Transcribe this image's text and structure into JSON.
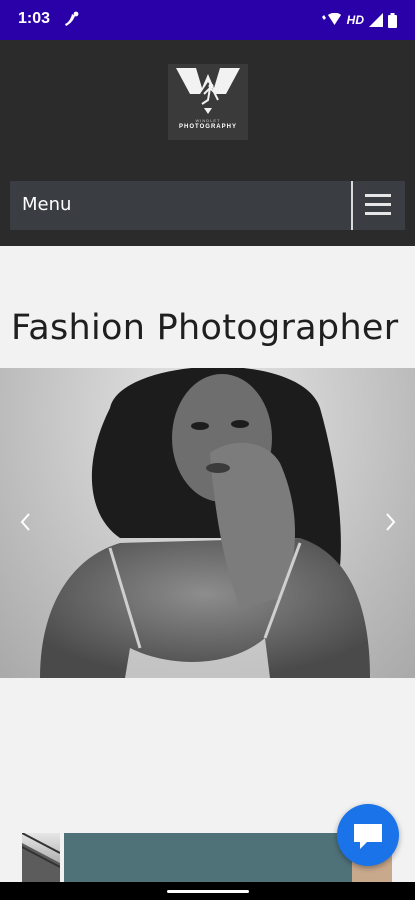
{
  "status_bar": {
    "time": "1:03",
    "network_label": "HD",
    "icons": [
      "notification-icon",
      "wifi-calling-icon",
      "signal-icon",
      "battery-icon"
    ]
  },
  "header": {
    "logo_top_text": "WINDLET",
    "logo_brand_text": "PHOTOGRAPHY",
    "menu_label": "Menu"
  },
  "main": {
    "title": "Fashion Photographer",
    "slider": {
      "prev_icon": "chevron-left-icon",
      "next_icon": "chevron-right-icon"
    }
  },
  "colors": {
    "status_bar": "#2a00a8",
    "header_bg": "#2b2b2c",
    "menu_bg": "#3a3d42",
    "page_bg": "#f2f2f2",
    "chat_button": "#1a73e8"
  }
}
